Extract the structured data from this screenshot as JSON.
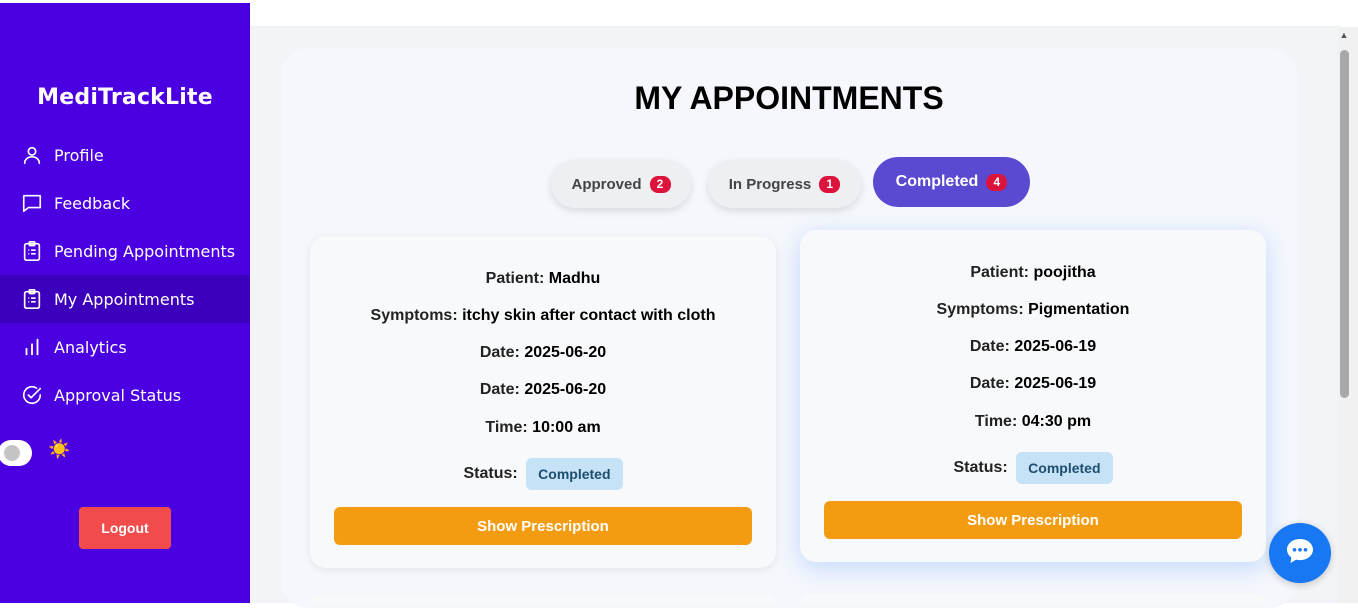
{
  "app": {
    "brand": "MediTrackLite"
  },
  "sidebar": {
    "items": [
      {
        "label": "Profile",
        "icon": "user-icon"
      },
      {
        "label": "Feedback",
        "icon": "message-square-icon"
      },
      {
        "label": "Pending Appointments",
        "icon": "clipboard-list-icon"
      },
      {
        "label": "My Appointments",
        "icon": "clipboard-list-icon",
        "active": true
      },
      {
        "label": "Analytics",
        "icon": "bar-chart-icon"
      },
      {
        "label": "Approval Status",
        "icon": "check-circle-icon"
      }
    ],
    "theme_toggle": {
      "icon": "sun-icon",
      "glyph": "☀️"
    },
    "logout_label": "Logout"
  },
  "main": {
    "title": "MY APPOINTMENTS",
    "tabs": [
      {
        "label": "Approved",
        "count": "2"
      },
      {
        "label": "In Progress",
        "count": "1"
      },
      {
        "label": "Completed",
        "count": "4",
        "active": true
      }
    ],
    "cards": [
      {
        "patient_label": "Patient:",
        "patient": "Madhu",
        "symptoms_label": "Symptoms:",
        "symptoms": "itchy skin after contact with cloth",
        "date_label": "Date:",
        "date1": "2025-06-20",
        "date2": "2025-06-20",
        "time_label": "Time:",
        "time": "10:00 am",
        "status_label": "Status:",
        "status": "Completed",
        "button": "Show Prescription"
      },
      {
        "patient_label": "Patient:",
        "patient": "poojitha",
        "symptoms_label": "Symptoms:",
        "symptoms": "Pigmentation",
        "date_label": "Date:",
        "date1": "2025-06-19",
        "date2": "2025-06-19",
        "time_label": "Time:",
        "time": "04:30 pm",
        "status_label": "Status:",
        "status": "Completed",
        "button": "Show Prescription"
      }
    ]
  },
  "chat": {
    "icon": "chat-bubble-icon"
  },
  "colors": {
    "sidebar": "#4a00e0",
    "active_tab": "#5a4ad1",
    "badge": "#dc143c",
    "prescription_button": "#f39c12",
    "logout": "#f24b4b",
    "status_pill": "#c5e2f6",
    "chat": "#1877f2"
  }
}
